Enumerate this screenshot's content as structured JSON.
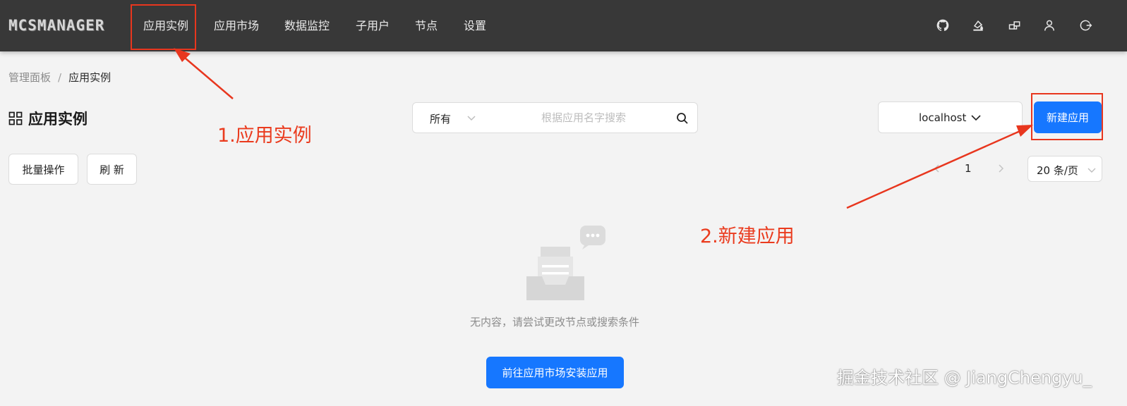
{
  "app": {
    "logo_text": "MCSMANAGER"
  },
  "nav": {
    "items": [
      {
        "label": "应用实例"
      },
      {
        "label": "应用市场"
      },
      {
        "label": "数据监控"
      },
      {
        "label": "子用户"
      },
      {
        "label": "节点"
      },
      {
        "label": "设置"
      }
    ],
    "icons": [
      "github-icon",
      "theme-brush-icon",
      "layout-icon",
      "user-icon",
      "logout-icon"
    ]
  },
  "breadcrumb": {
    "root": "管理面板",
    "separator": "/",
    "current": "应用实例"
  },
  "page": {
    "title": "应用实例"
  },
  "filter": {
    "selected": "所有",
    "search_placeholder": "根据应用名字搜索",
    "search_value": ""
  },
  "node_select": {
    "selected": "localhost"
  },
  "actions": {
    "new_label": "新建应用",
    "batch_label": "批量操作",
    "refresh_label": "刷 新"
  },
  "pagination": {
    "current_page": "1",
    "page_size": "20 条/页"
  },
  "empty": {
    "message": "无内容，请尝试更改节点或搜索条件",
    "button_label": "前往应用市场安装应用"
  },
  "annotations": {
    "step1": "1.应用实例",
    "step2": "2.新建应用",
    "color": "#e8361e"
  },
  "watermark": "掘金技术社区 @ JiangChengyu_",
  "colors": {
    "topbar": "#383838",
    "primary": "#1677ff",
    "background": "#f3f3f3"
  }
}
